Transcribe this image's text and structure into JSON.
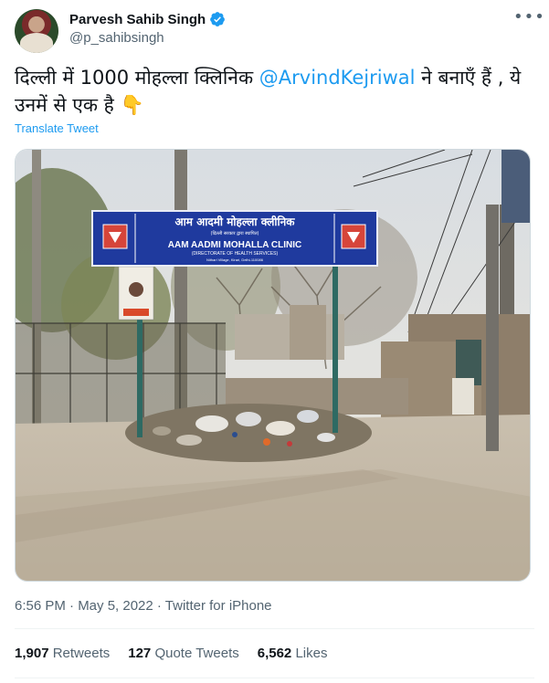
{
  "author": {
    "name": "Parvesh Sahib Singh",
    "handle": "@p_sahibsingh"
  },
  "more_icon": "more-icon",
  "tweet": {
    "text_part1": "दिल्ली में 1000 मोहल्ला क्लिनिक ",
    "mention": "@ArvindKejriwal",
    "text_part2": " ने बनाएँ हैं , ये उनमें से एक है ",
    "emoji": "👇"
  },
  "translate_label": "Translate Tweet",
  "sign": {
    "hindi_title": "आम आदमी मोहल्ला क्लीनिक",
    "hindi_sub": "(दिल्ली सरकार द्वारा स्थापित)",
    "english_title": "AAM AADMI MOHALLA CLINIC",
    "dept": "(DIRECTORATE OF HEALTH SERVICES)",
    "address": "Nithari Village, Kirari, Delhi-110086"
  },
  "meta": "6:56 PM · May 5, 2022 · Twitter for iPhone",
  "stats": [
    {
      "count": "1,907",
      "label": "Retweets"
    },
    {
      "count": "127",
      "label": "Quote Tweets"
    },
    {
      "count": "6,562",
      "label": "Likes"
    }
  ],
  "colors": {
    "accent": "#1d9bf0",
    "sign_blue": "#1f3a9e",
    "muted": "#536471"
  }
}
